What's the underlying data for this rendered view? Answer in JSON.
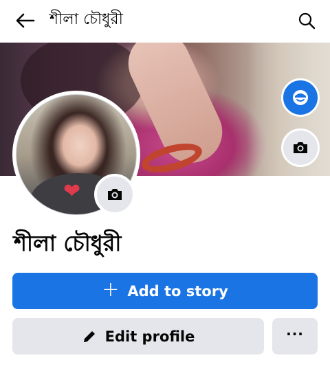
{
  "topbar": {
    "title": "শীলা চৌধুরী",
    "back_icon": "arrow-left-icon",
    "search_icon": "search-icon"
  },
  "cover": {
    "camera_icon": "camera-icon",
    "avatar_icon": "avatar-icon"
  },
  "profile": {
    "name": "শীলা চৌধুরী",
    "camera_icon": "camera-icon"
  },
  "actions": {
    "add_story_icon": "plus-icon",
    "add_story_plus": "+",
    "add_story_label": "Add to story",
    "edit_profile_icon": "pencil-icon",
    "edit_profile_label": "Edit profile",
    "more_icon": "more-horizontal-icon",
    "more_label": "···"
  },
  "colors": {
    "primary": "#1b74e4",
    "secondary_button": "#e4e6eb",
    "text": "#050505",
    "background": "#ffffff"
  }
}
